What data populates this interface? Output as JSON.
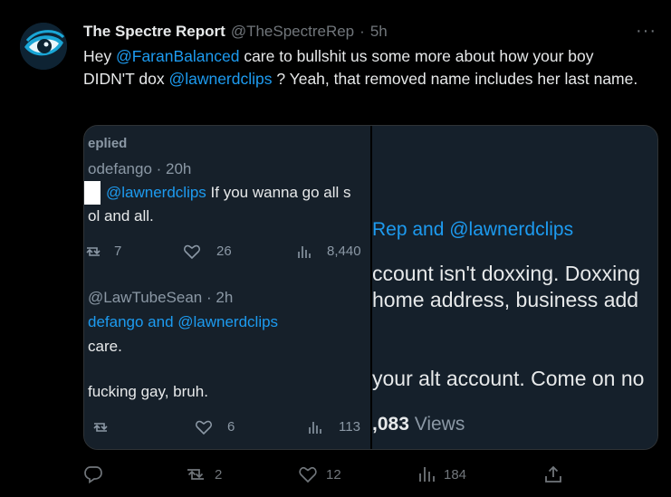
{
  "tweet": {
    "display_name": "The Spectre Report",
    "handle": "@TheSpectreRep",
    "separator": "·",
    "time": "5h",
    "more": "···",
    "text_parts": {
      "p1": "Hey ",
      "m1": "@FaranBalanced",
      "p2": " care to bullshit us some more about how your boy DIDN'T dox ",
      "m2": "@lawnerdclips",
      "p3": " ?  Yeah, that removed name includes her last name."
    }
  },
  "media": {
    "left": {
      "replied": "eplied",
      "author1": "odefango · 20h",
      "line1_mention": "@lawnerdclips",
      "line1_text": " If you wanna go all s",
      "line2": "ol and all.",
      "retweets1": "7",
      "likes1": "26",
      "views1": "8,440",
      "author2": "@LawTubeSean · 2h",
      "replying2": "defango and @lawnerdclips",
      "text2a": "care.",
      "text2b": "fucking gay, bruh.",
      "likes2": "6",
      "views2": "113"
    },
    "right": {
      "replying": "Rep and @lawnerdclips",
      "line1": "ccount isn't doxxing. Doxxing",
      "line2": "home address, business add",
      "line3": "your alt account. Come on no",
      "views_num": ",083",
      "views_label": " Views"
    }
  },
  "actions": {
    "reply_count": "",
    "retweet_count": "2",
    "like_count": "12",
    "view_count": "184"
  }
}
